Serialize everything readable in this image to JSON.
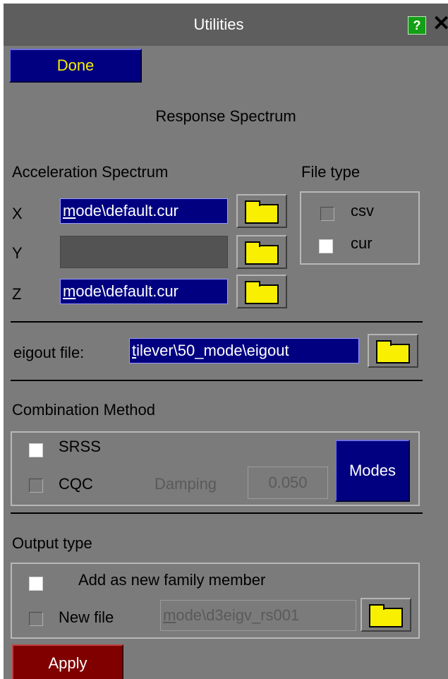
{
  "window": {
    "title": "Utilities",
    "help_label": "?",
    "close_label": "✕"
  },
  "toolbar": {
    "done_label": "Done"
  },
  "section_title": "Response Spectrum",
  "acceleration": {
    "heading": "Acceleration Spectrum",
    "x": {
      "label": "X",
      "caret": "m",
      "value_rest": "ode\\default.cur"
    },
    "y": {
      "label": "Y",
      "value": ""
    },
    "z": {
      "label": "Z",
      "caret": "m",
      "value_rest": "ode\\default.cur"
    }
  },
  "file_type": {
    "heading": "File type",
    "options": [
      {
        "label": "csv",
        "checked": false
      },
      {
        "label": "cur",
        "checked": true
      }
    ]
  },
  "eigout": {
    "label": "eigout file:",
    "caret": "t",
    "value_rest": "ilever\\50_mode\\eigout"
  },
  "combination": {
    "heading": "Combination Method",
    "srss": {
      "label": "SRSS",
      "checked": true
    },
    "cqc": {
      "label": "CQC",
      "checked": false
    },
    "damping_label": "Damping",
    "damping_value": "0.050",
    "modes_label": "Modes"
  },
  "output": {
    "heading": "Output type",
    "add_member": {
      "label": "Add as new family member",
      "checked": true
    },
    "new_file": {
      "label": "New file",
      "checked": false
    },
    "file_caret": "m",
    "file_rest": "ode\\d3eigv_rs001"
  },
  "apply_label": "Apply",
  "colors": {
    "panel": "#7b7b7b",
    "title_bar": "#5e5e5e",
    "field_active": "#000081",
    "folder": "#f8f000",
    "apply": "#800000",
    "help": "#14a014"
  }
}
